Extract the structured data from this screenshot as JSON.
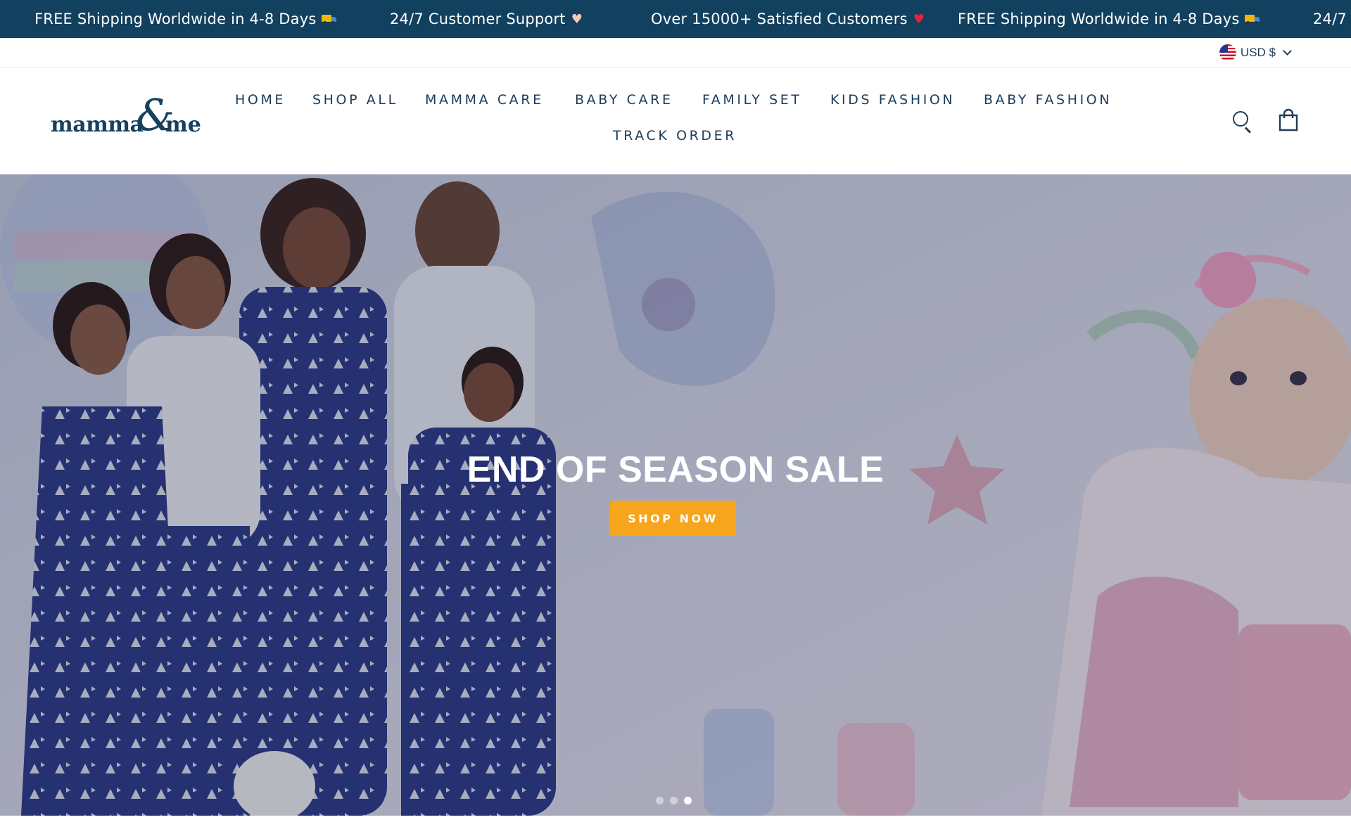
{
  "announcement_bar": {
    "messages": [
      {
        "text": "FREE Shipping Worldwide in 4-8 Days",
        "icon": "truck-icon"
      },
      {
        "text": "24/7 Customer Support",
        "icon": "heart-hands-icon"
      },
      {
        "text": "Over 15000+ Satisfied Customers",
        "icon": "red-heart-icon"
      },
      {
        "text": "FREE Shipping Worldwide in 4-8 Days",
        "icon": "truck-icon"
      },
      {
        "text": "24/7",
        "icon": ""
      }
    ],
    "background_color": "#12405f"
  },
  "currency": {
    "label": "USD $",
    "flag_icon": "us-flag-icon"
  },
  "logo": {
    "part1": "mamma",
    "ampersand": "&",
    "part2": "me"
  },
  "nav": {
    "items": [
      {
        "label": "HOME"
      },
      {
        "label": "SHOP ALL"
      },
      {
        "label": "MAMMA CARE"
      },
      {
        "label": "BABY CARE"
      },
      {
        "label": "FAMILY SET"
      },
      {
        "label": "KIDS FASHION"
      },
      {
        "label": "BABY FASHION"
      },
      {
        "label": "TRACK ORDER"
      }
    ]
  },
  "header_icons": {
    "search": "search-icon",
    "cart": "cart-icon"
  },
  "hero": {
    "title": "END OF SEASON SALE",
    "cta_label": "SHOP NOW",
    "cta_color": "#f7a51c",
    "slide_count": 3,
    "active_slide": 3
  }
}
